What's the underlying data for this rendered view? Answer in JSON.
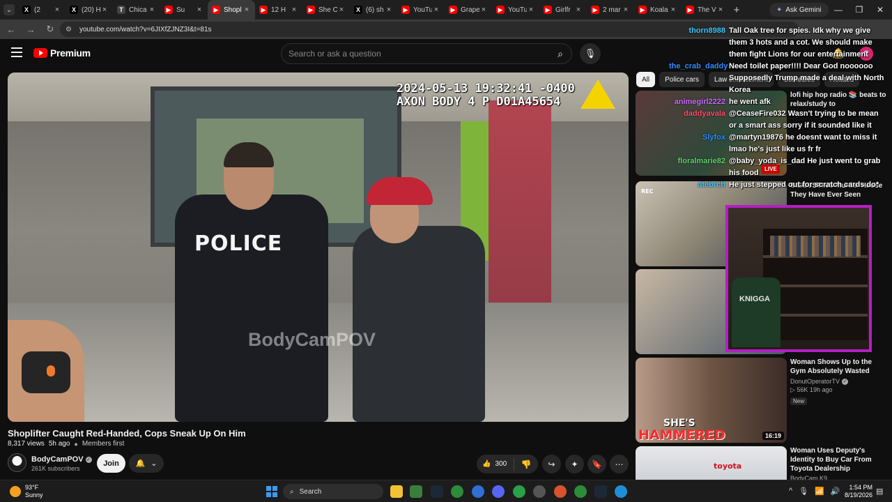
{
  "browser": {
    "tabs": [
      {
        "title": "(2",
        "fav": "X",
        "color": "#000000",
        "active": false
      },
      {
        "title": "(20) H",
        "fav": "X",
        "color": "#000000",
        "active": false
      },
      {
        "title": "Chica",
        "fav": "T",
        "color": "#444444",
        "active": false
      },
      {
        "title": "Su",
        "fav": "▶",
        "color": "#ff0000",
        "active": false
      },
      {
        "title": "Shopl",
        "fav": "▶",
        "color": "#ff0000",
        "active": true
      },
      {
        "title": "12 H",
        "fav": "▶",
        "color": "#ff0000",
        "active": false
      },
      {
        "title": "She C",
        "fav": "▶",
        "color": "#ff0000",
        "active": false
      },
      {
        "title": "(6) sh",
        "fav": "X",
        "color": "#000000",
        "active": false
      },
      {
        "title": "YouTu",
        "fav": "▶",
        "color": "#ff0000",
        "active": false
      },
      {
        "title": "Grape",
        "fav": "▶",
        "color": "#ff0000",
        "active": false
      },
      {
        "title": "YouTu",
        "fav": "▶",
        "color": "#ff0000",
        "active": false
      },
      {
        "title": "Girlfr",
        "fav": "▶",
        "color": "#ff0000",
        "active": false
      },
      {
        "title": "2 mar",
        "fav": "▶",
        "color": "#ff0000",
        "active": false
      },
      {
        "title": "Koala",
        "fav": "▶",
        "color": "#ff0000",
        "active": false
      },
      {
        "title": "The V",
        "fav": "▶",
        "color": "#ff0000",
        "active": false
      }
    ],
    "new_tab": "+",
    "ask_gemini": "Ask Gemini",
    "url": "youtube.com/watch?v=6JIXfZJNZ3I&t=81s"
  },
  "header": {
    "logo_text": "Premium",
    "search_placeholder": "Search or ask a question",
    "avatar_letter": "C"
  },
  "video": {
    "timestamp_line1": "2024-05-13 19:32:41 -0400",
    "timestamp_line2": "AXON BODY 4 P D01A45654",
    "vest_text": "POLICE",
    "watermark": "BodyCamPOV",
    "title": "Shoplifter Caught Red-Handed, Cops Sneak Up On Him",
    "views": "8,317 views",
    "age": "5h ago",
    "members": "Members first",
    "channel": "BodyCamPOV",
    "subscribers": "261K subscribers",
    "join_label": "Join",
    "likes": "300"
  },
  "chips": [
    {
      "label": "All",
      "active": true
    },
    {
      "label": "Police cars",
      "active": false
    },
    {
      "label": "Law enforcement",
      "active": false
    },
    {
      "label": "Comedies",
      "active": false
    },
    {
      "label": "Related",
      "active": false
    }
  ],
  "recommendations": [
    {
      "title": "lofi hip hop radio 📚 beats to relax/study to",
      "channel": "",
      "stats": "",
      "badge": "",
      "live": "LIVE",
      "duration": ""
    },
    {
      "title": "DISGUSTING Murder House They Have Ever Seen",
      "channel": "",
      "stats": "",
      "badge": "",
      "live": "",
      "duration": ""
    },
    {
      "title": "",
      "channel": "",
      "stats": "",
      "badge": "",
      "live": "",
      "duration": ""
    },
    {
      "title": "Woman Shows Up to the Gym Absolutely Wasted",
      "channel": "DonutOperatorTV",
      "stats": "▷ 56K  19h ago",
      "badge": "New",
      "live": "",
      "duration": "16:19"
    },
    {
      "title": "Woman Uses Deputy's Identity to Buy Car From Toyota Dealership",
      "channel": "BodyCam K9",
      "stats": "",
      "badge": "",
      "live": "",
      "duration": ""
    }
  ],
  "thumb_texts": {
    "hammered_1": "SHE'S",
    "hammered_2": "HAMMERED",
    "rec_label": "REC",
    "toyota": "toyota"
  },
  "chat": [
    {
      "user": "thorn8988",
      "color": "#3ec6ff",
      "msg": "Tall Oak tree for spies. Idk why we give them 3 hots and a cot. We should make them fight Lions for our entertainment"
    },
    {
      "user": "the_crab_daddy",
      "color": "#2f8cff",
      "msg": "Need toilet paper!!!! Dear God noooooo"
    },
    {
      "user": "",
      "color": "#ffffff",
      "msg": "Supposedly Trump made a deal with North Korea"
    },
    {
      "user": "animegirl2222",
      "color": "#c86bff",
      "msg": "he went afk"
    },
    {
      "user": "daddyavala",
      "color": "#ff4f6d",
      "msg": "@CeaseFire032 Wasn't trying to be mean or a smart ass sorry if it sounded like it"
    },
    {
      "user": "Slyfox",
      "color": "#2f8cff",
      "msg": "@martyn19876 he doesnt want to miss it lmao he's just like us fr fr"
    },
    {
      "user": "floralmarie82",
      "color": "#62d36b",
      "msg": "@baby_yoda_is_dad He just went to grab his food"
    },
    {
      "user": "atebrch",
      "color": "#3ec6ff",
      "msg": "He just stepped out for scratch cards do*"
    }
  ],
  "cam": {
    "jersey": "KNIGGA"
  },
  "taskbar": {
    "temp": "93°F",
    "condition": "Sunny",
    "search_label": "Search",
    "time": "1:54 PM",
    "date": "8/19/2026"
  },
  "colors": {
    "yt_red": "#ff0000",
    "cam_border": "#b51ec4",
    "live_red": "#cc0000"
  }
}
